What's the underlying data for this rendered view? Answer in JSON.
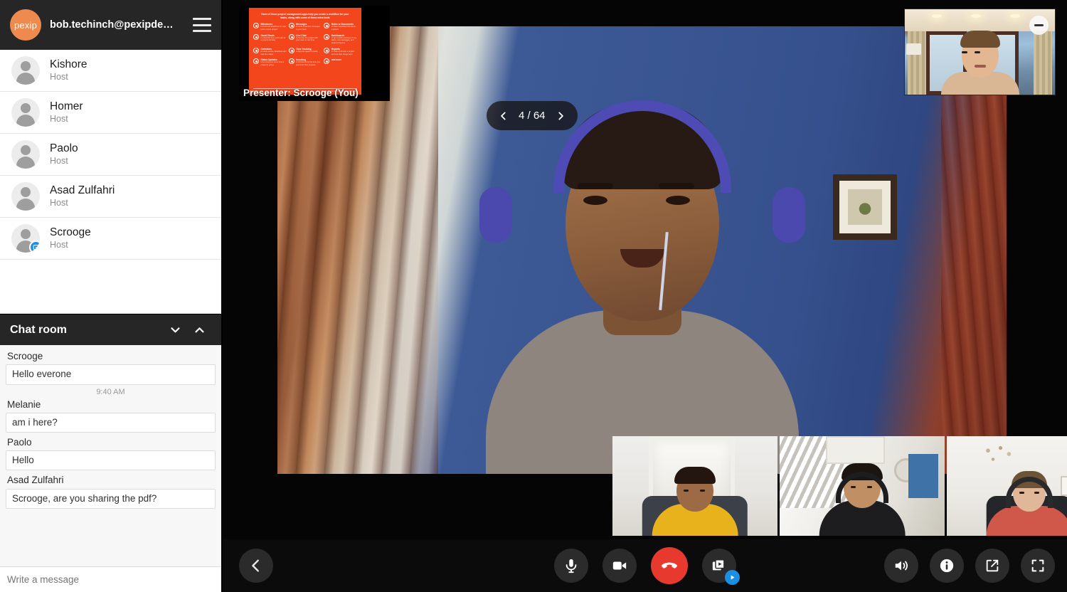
{
  "app": {
    "brand_name": "pexip",
    "brand_color": "#ee8a4e",
    "account_email": "bob.techinch@pexipde…",
    "menu_icon": "hamburger-menu-icon"
  },
  "participants": {
    "items": [
      {
        "name": "Kishore",
        "role": "Host",
        "presenting": false
      },
      {
        "name": "Homer",
        "role": "Host",
        "presenting": false
      },
      {
        "name": "Paolo",
        "role": "Host",
        "presenting": false
      },
      {
        "name": "Asad Zulfahri",
        "role": "Host",
        "presenting": false
      },
      {
        "name": "Scrooge",
        "role": "Host",
        "presenting": true
      }
    ]
  },
  "chat": {
    "title": "Chat room",
    "collapse_icon": "chevron-down-icon",
    "expand_icon": "chevron-up-icon",
    "messages": [
      {
        "author": "Scrooge",
        "text": "Hello everone",
        "time": "9:40 AM"
      },
      {
        "author": "Melanie",
        "text": "am i here?",
        "time": ""
      },
      {
        "author": "Paolo",
        "text": "Hello",
        "time": ""
      },
      {
        "author": "Asad Zulfahri",
        "text": "Scrooge, are you sharing the pdf?",
        "time": ""
      }
    ],
    "input_placeholder": "Write a message",
    "input_value": ""
  },
  "presentation": {
    "presenter_label": "Presenter: Scrooge (You)",
    "current_page": "4",
    "total_pages": "64",
    "page_counter": "4 / 64",
    "prev_icon": "chevron-left-icon",
    "next_icon": "chevron-right-icon",
    "slide": {
      "accent_color": "#f4461c",
      "heading": "Each of these project management apps help you create a workflow for your tasks, along with some of these extra tools",
      "features": [
        {
          "title": "Milestones",
          "desc": "to hit broad deadlines for core parts of your project"
        },
        {
          "title": "Messages",
          "desc": "to send email-like messages to your team"
        },
        {
          "title": "Notes or Documents",
          "desc": "to share important info about a project"
        },
        {
          "title": "Gantt Charts",
          "desc": "to show the time each part of a project will take"
        },
        {
          "title": "Live Chat",
          "desc": "to discuss the project with your team in real time"
        },
        {
          "title": "Dashboards",
          "desc": "to get a quick overview of key tasks, new messages, and project progress"
        },
        {
          "title": "Calendars",
          "desc": "to show events, deadlines and task due dates"
        },
        {
          "title": "Time Tracking",
          "desc": "to log time spent on tasks"
        },
        {
          "title": "Reports",
          "desc": "to track work over a project and see how things went"
        },
        {
          "title": "Status Updates",
          "desc": "to let everyone know how a project is going"
        },
        {
          "title": "Invoicing",
          "desc": "to bill clients for the time you spend on their projects"
        },
        {
          "title": "and more",
          "desc": ""
        }
      ],
      "footer_left": "Zapier",
      "footer_right": "The Ultimate Guide to Project Management Apps"
    }
  },
  "selfview": {
    "minimize_icon": "minimize-icon",
    "label": ""
  },
  "filmstrip": {
    "tiles": [
      {
        "name": "participant-thumbnail-1"
      },
      {
        "name": "participant-thumbnail-2"
      },
      {
        "name": "participant-thumbnail-3"
      }
    ]
  },
  "toolbar": {
    "back_icon": "chevron-left-icon",
    "microphone_icon": "microphone-icon",
    "camera_icon": "camera-icon",
    "hangup_icon": "hangup-phone-icon",
    "present_icon": "presentation-slides-icon",
    "present_badge_icon": "play-badge-icon",
    "speaker_icon": "speaker-volume-icon",
    "info_icon": "info-icon",
    "share_icon": "external-link-icon",
    "fullscreen_icon": "fullscreen-icon"
  }
}
